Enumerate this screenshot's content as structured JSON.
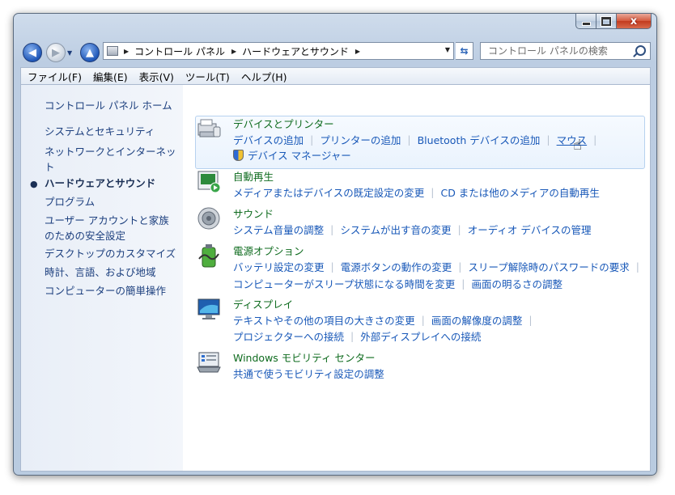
{
  "window": {
    "min_label": "",
    "max_label": "",
    "close_label": "x"
  },
  "nav": {
    "breadcrumbs": [
      "コントロール パネル",
      "ハードウェアとサウンド"
    ],
    "search_placeholder": "コントロール パネルの検索"
  },
  "menu": [
    "ファイル(F)",
    "編集(E)",
    "表示(V)",
    "ツール(T)",
    "ヘルプ(H)"
  ],
  "sidebar": {
    "home": "コントロール パネル ホーム",
    "items": [
      "システムとセキュリティ",
      "ネットワークとインターネット",
      "ハードウェアとサウンド",
      "プログラム",
      "ユーザー アカウントと家族のための安全設定",
      "デスクトップのカスタマイズ",
      "時計、言語、および地域",
      "コンピューターの簡単操作"
    ],
    "active_index": 2
  },
  "sections": {
    "devices": {
      "title": "デバイスとプリンター",
      "links": [
        "デバイスの追加",
        "プリンターの追加",
        "Bluetooth デバイスの追加",
        "マウス"
      ],
      "links2": [
        "デバイス マネージャー"
      ]
    },
    "autoplay": {
      "title": "自動再生",
      "links": [
        "メディアまたはデバイスの既定設定の変更",
        "CD または他のメディアの自動再生"
      ]
    },
    "sound": {
      "title": "サウンド",
      "links": [
        "システム音量の調整",
        "システムが出す音の変更",
        "オーディオ デバイスの管理"
      ]
    },
    "power": {
      "title": "電源オプション",
      "links": [
        "バッテリ設定の変更",
        "電源ボタンの動作の変更",
        "スリープ解除時のパスワードの要求"
      ],
      "links2": [
        "コンピューターがスリープ状態になる時間を変更",
        "画面の明るさの調整"
      ]
    },
    "display": {
      "title": "ディスプレイ",
      "links": [
        "テキストやその他の項目の大きさの変更",
        "画面の解像度の調整"
      ],
      "links2": [
        "プロジェクターへの接続",
        "外部ディスプレイへの接続"
      ]
    },
    "mobility": {
      "title": "Windows モビリティ センター",
      "links": [
        "共通で使うモビリティ設定の調整"
      ]
    }
  }
}
